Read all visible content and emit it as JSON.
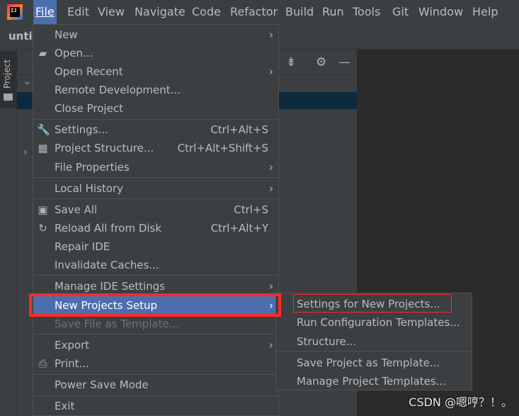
{
  "menubar": {
    "logo_text": "IJ",
    "items": [
      "File",
      "Edit",
      "View",
      "Navigate",
      "Code",
      "Refactor",
      "Build",
      "Run",
      "Tools",
      "Git",
      "Window",
      "Help"
    ],
    "active": "File"
  },
  "project": {
    "name": "untit",
    "tool_window_label": "Project"
  },
  "file_menu": {
    "new": "New",
    "open": "Open...",
    "open_recent": "Open Recent",
    "remote_development": "Remote Development...",
    "close_project": "Close Project",
    "settings": "Settings...",
    "settings_shortcut": "Ctrl+Alt+S",
    "project_structure": "Project Structure...",
    "project_structure_shortcut": "Ctrl+Alt+Shift+S",
    "file_properties": "File Properties",
    "local_history": "Local History",
    "save_all": "Save All",
    "save_all_shortcut": "Ctrl+S",
    "reload_all": "Reload All from Disk",
    "reload_all_shortcut": "Ctrl+Alt+Y",
    "repair_ide": "Repair IDE",
    "invalidate_caches": "Invalidate Caches...",
    "manage_ide_settings": "Manage IDE Settings",
    "new_projects_setup": "New Projects Setup",
    "save_file_as_template": "Save File as Template...",
    "export": "Export",
    "print": "Print...",
    "power_save_mode": "Power Save Mode",
    "exit": "Exit"
  },
  "submenu": {
    "settings_for_new_projects": "Settings for New Projects...",
    "run_configuration_templates": "Run Configuration Templates...",
    "structure": "Structure...",
    "save_project_as_template": "Save Project as Template...",
    "manage_project_templates": "Manage Project Templates..."
  },
  "watermark": "CSDN @嗯哼？！。",
  "colors": {
    "highlight": "#4b6eaf",
    "annotation": "#ff2a2a",
    "menu_bg": "#3c3f41"
  }
}
